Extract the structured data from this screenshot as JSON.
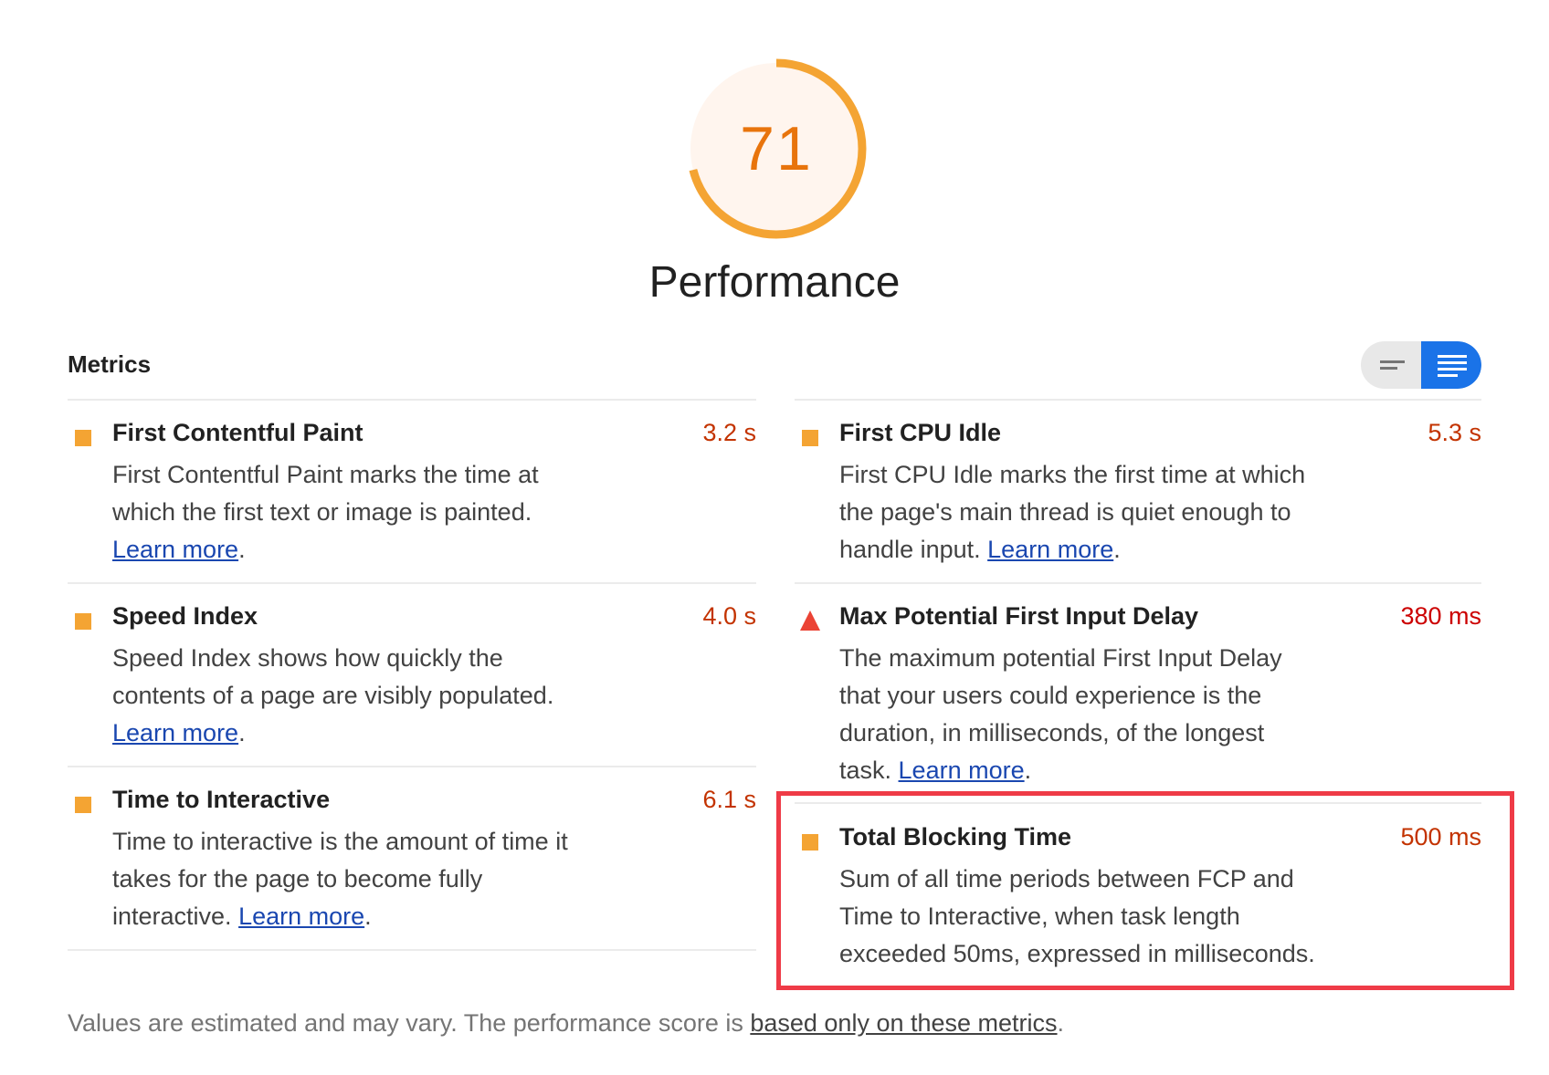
{
  "gauge": {
    "score": "71",
    "score_fraction": 0.71,
    "color": "#f4a433",
    "fill_color": "#fff5ee",
    "score_text_color": "#e8740c"
  },
  "category_title": "Performance",
  "metrics_heading": "Metrics",
  "view_toggle": {
    "left_icon": "collapsed-view-icon",
    "right_icon": "expanded-view-icon",
    "active": "expanded",
    "active_color": "#1a73e8"
  },
  "metrics": [
    {
      "title": "First Contentful Paint",
      "value": "3.2 s",
      "status": "average",
      "icon": "orange-square-icon",
      "desc_lines": [
        "First Contentful Paint marks the time at",
        "which the first text or image is painted."
      ],
      "desc_tail": "",
      "link": "Learn more",
      "after": "."
    },
    {
      "title": "First CPU Idle",
      "value": "5.3 s",
      "status": "average",
      "icon": "orange-square-icon",
      "desc_lines": [
        "First CPU Idle marks the first time at which",
        "the page's main thread is quiet enough to"
      ],
      "desc_tail": "handle input. ",
      "link": "Learn more",
      "after": "."
    },
    {
      "title": "Speed Index",
      "value": "4.0 s",
      "status": "average",
      "icon": "orange-square-icon",
      "desc_lines": [
        "Speed Index shows how quickly the",
        "contents of a page are visibly populated."
      ],
      "desc_tail": "",
      "link": "Learn more",
      "after": "."
    },
    {
      "title": "Max Potential First Input Delay",
      "value": "380 ms",
      "status": "fail",
      "icon": "red-triangle-icon",
      "desc_lines": [
        "The maximum potential First Input Delay",
        "that your users could experience is the",
        "duration, in milliseconds, of the longest"
      ],
      "desc_tail": "task. ",
      "link": "Learn more",
      "after": "."
    },
    {
      "title": "Time to Interactive",
      "value": "6.1 s",
      "status": "average",
      "icon": "orange-square-icon",
      "desc_lines": [
        "Time to interactive is the amount of time it",
        "takes for the page to become fully"
      ],
      "desc_tail": "interactive. ",
      "link": "Learn more",
      "after": "."
    },
    {
      "title": "Total Blocking Time",
      "value": "500 ms",
      "status": "average",
      "icon": "orange-square-icon",
      "desc_lines": [
        "Sum of all time periods between FCP and",
        "Time to Interactive, when task length",
        "exceeded 50ms, expressed in milliseconds."
      ],
      "desc_tail": "",
      "link": "",
      "after": ""
    }
  ],
  "footer": {
    "text": "Values are estimated and may vary. The performance score is ",
    "link": "based only on these metrics",
    "after": "."
  },
  "colors": {
    "average": "#f4a433",
    "fail": "#eb4335",
    "average_value": "#c33300",
    "fail_value": "#cc0000",
    "link": "#1a47b0",
    "highlight": "#ef3b47"
  }
}
